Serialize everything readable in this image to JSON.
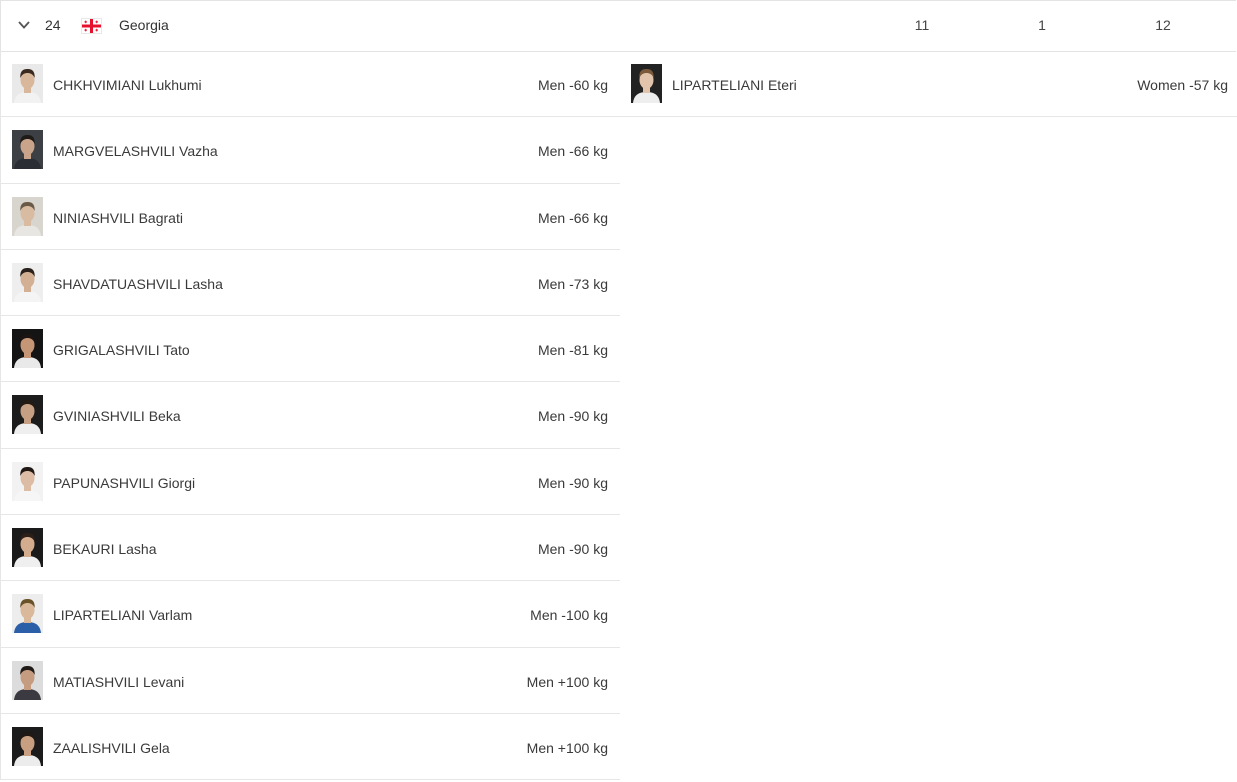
{
  "country_row": {
    "rank": "24",
    "flag_icon": "georgia-flag-icon",
    "country": "Georgia",
    "men_count": "11",
    "women_count": "1",
    "total_count": "12"
  },
  "colors": {
    "flag_red": "#e8112d",
    "border": "#e6e6e6",
    "text": "#333333"
  },
  "men": [
    {
      "name": "CHKHVIMIANI Lukhumi",
      "category": "Men -60 kg",
      "skin": "#d9b79a",
      "hair": "#3a2a20",
      "bg": "#e9e9e9",
      "shirt": "#f2f2f2"
    },
    {
      "name": "MARGVELASHVILI Vazha",
      "category": "Men -66 kg",
      "skin": "#c9a48a",
      "hair": "#1e1a18",
      "bg": "#3c3f44",
      "shirt": "#2a2d33"
    },
    {
      "name": "NINIASHVILI Bagrati",
      "category": "Men -66 kg",
      "skin": "#d8bba0",
      "hair": "#6b5a48",
      "bg": "#d8d5cf",
      "shirt": "#e8e6e2"
    },
    {
      "name": "SHAVDATUASHVILI Lasha",
      "category": "Men -73 kg",
      "skin": "#d3b093",
      "hair": "#2a211c",
      "bg": "#eeeeee",
      "shirt": "#f4f4f4"
    },
    {
      "name": "GRIGALASHVILI Tato",
      "category": "Men -81 kg",
      "skin": "#c49676",
      "hair": "#1c1412",
      "bg": "#141414",
      "shirt": "#e9e9e9"
    },
    {
      "name": "GVINIASHVILI Beka",
      "category": "Men -90 kg",
      "skin": "#c7a083",
      "hair": "#231a14",
      "bg": "#1c1c1c",
      "shirt": "#efefef"
    },
    {
      "name": "PAPUNASHVILI Giorgi",
      "category": "Men -90 kg",
      "skin": "#dcbca4",
      "hair": "#201815",
      "bg": "#f2f2f2",
      "shirt": "#f6f6f6"
    },
    {
      "name": "BEKAURI Lasha",
      "category": "Men -90 kg",
      "skin": "#d4ad8e",
      "hair": "#2b1f18",
      "bg": "#1a1a1a",
      "shirt": "#efefef"
    },
    {
      "name": "LIPARTELIANI Varlam",
      "category": "Men -100 kg",
      "skin": "#dab89a",
      "hair": "#6a5228",
      "bg": "#ededed",
      "shirt": "#2b5fa8"
    },
    {
      "name": "MATIASHVILI Levani",
      "category": "Men +100 kg",
      "skin": "#c69c80",
      "hair": "#1f1a18",
      "bg": "#dcdcdc",
      "shirt": "#3a3a40"
    },
    {
      "name": "ZAALISHVILI Gela",
      "category": "Men +100 kg",
      "skin": "#c99f82",
      "hair": "#1f1814",
      "bg": "#1b1b1b",
      "shirt": "#ececec"
    }
  ],
  "women": [
    {
      "name": "LIPARTELIANI Eteri",
      "category": "Women -57 kg",
      "skin": "#e2c4ac",
      "hair": "#7a5a3a",
      "bg": "#222222",
      "shirt": "#eeeeee"
    }
  ]
}
